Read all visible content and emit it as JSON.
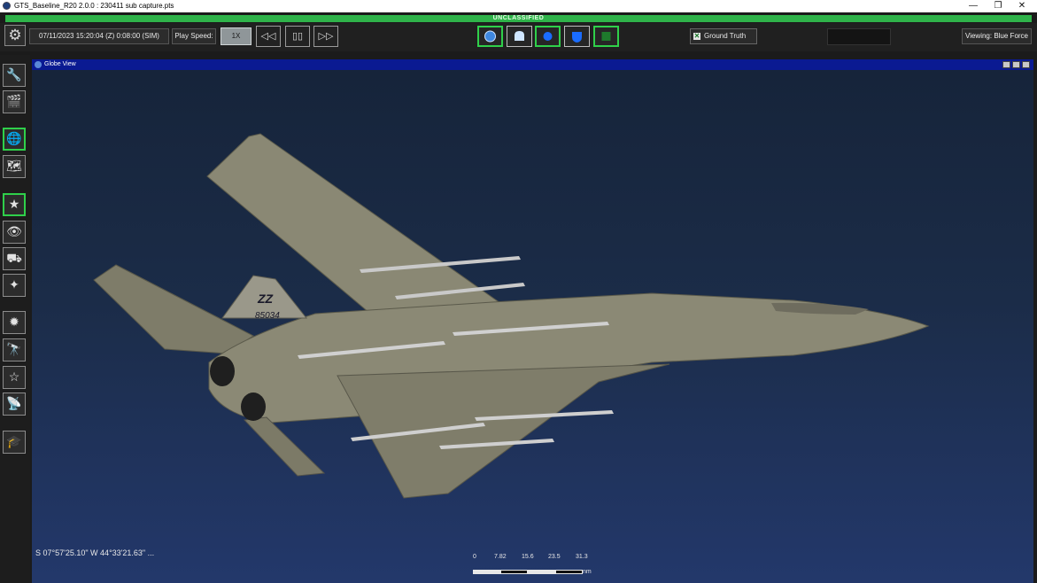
{
  "window": {
    "title": "GTS_Baseline_R20 2.0.0 : 230411 sub capture.pts",
    "controls": [
      "—",
      "❐",
      "✕"
    ]
  },
  "classification": "UNCLASSIFIED",
  "toolbar": {
    "sim_time": "07/11/2023 15:20:04 (Z) 0:08:00 (SIM)",
    "play_speed_label": "Play Speed:",
    "play_speed_value": "1X",
    "rewind_glyph": "◁◁",
    "pause_glyph": "▯▯",
    "forward_glyph": "▷▷",
    "ground_truth_label": "Ground Truth",
    "viewing_label": "Viewing: Blue Force",
    "mode_icons": [
      "globe-icon",
      "ground-unit-icon",
      "air-unit-icon",
      "shield-icon",
      "square-icon"
    ]
  },
  "sidebar": {
    "icons": [
      "tools-icon",
      "clapperboard-icon",
      "globe-3d-icon",
      "map-view-icon",
      "star-list-icon",
      "eye-icon",
      "vehicle-layers-icon",
      "star-asset-icon",
      "sensor-icon",
      "telescope-target-icon",
      "telescope-star-icon",
      "satellite-dish-icon",
      "graduation-icon"
    ]
  },
  "globe_view": {
    "title": "Globe View",
    "coordinates": "S 07°57'25.10\" W 44°33'21.63\" ...",
    "scale_labels": [
      "0",
      "7.82",
      "15.6",
      "23.5",
      "31.3"
    ],
    "scale_unit": "nm",
    "aircraft": {
      "tail_code": "ZZ",
      "serial": "85034"
    }
  },
  "colors": {
    "classification_green": "#2fb34a",
    "active_green": "#2fd04a",
    "globe_header_blue": "#0a1a92",
    "aircraft_gray": "#85836f"
  }
}
